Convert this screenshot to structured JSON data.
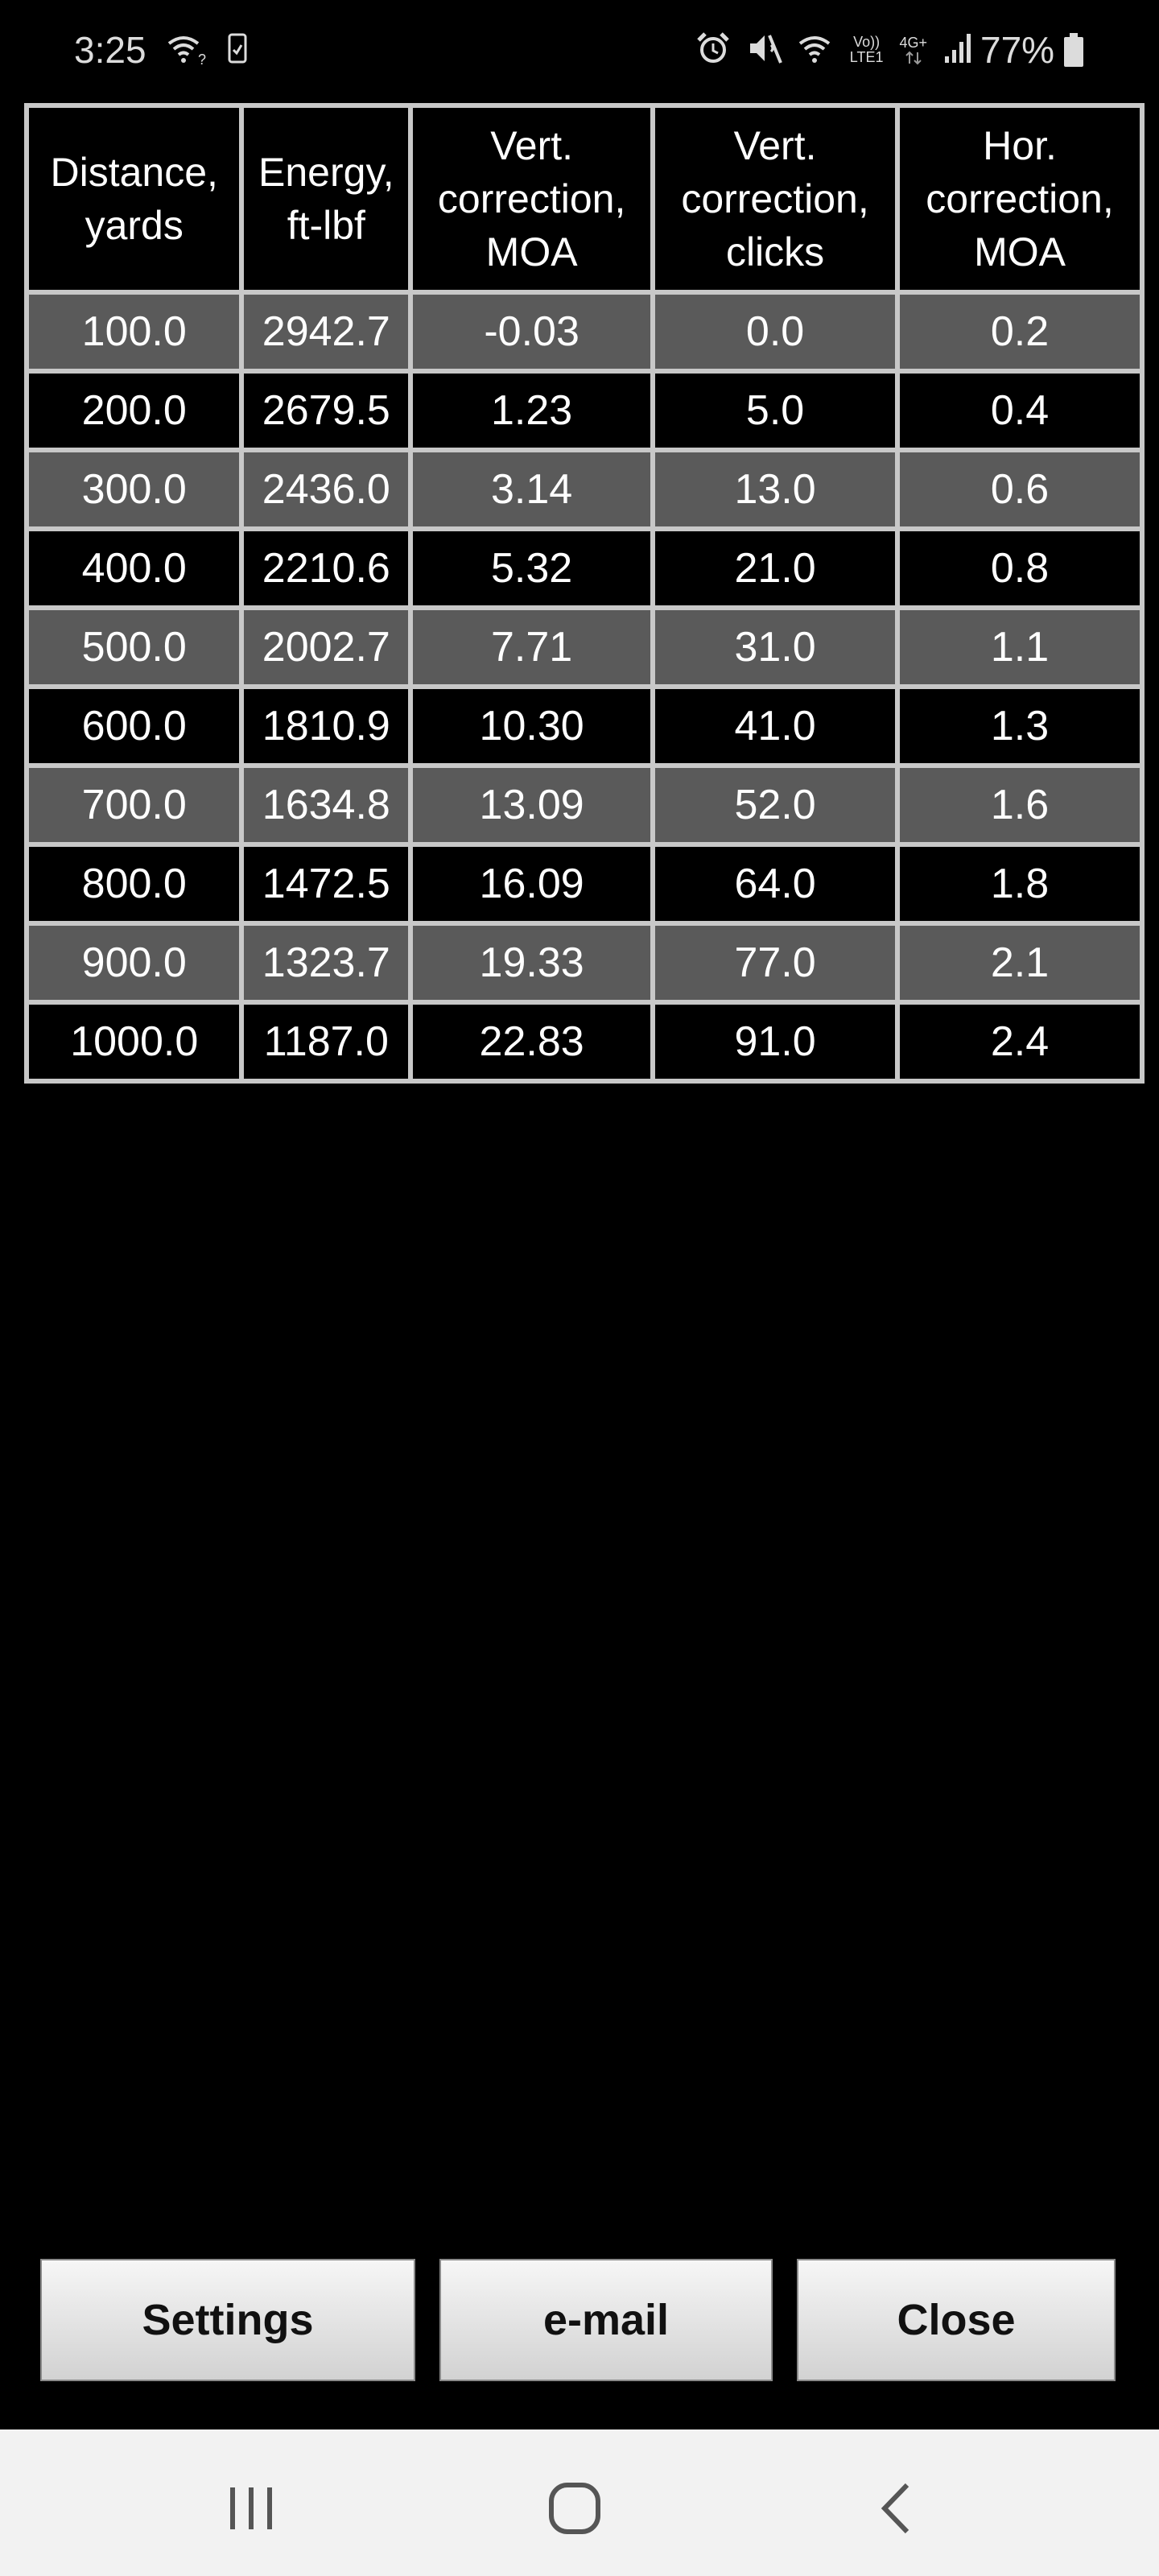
{
  "status_bar": {
    "time": "3:25",
    "battery_percent": "77%",
    "volte_label_top": "Vo))",
    "volte_label_bottom": "LTE1",
    "network_label": "4G+",
    "left_icons": [
      "wifi-question-icon",
      "screenshot-phone-icon"
    ],
    "right_icons": [
      "alarm-icon",
      "mute-icon",
      "wifi-calling-icon",
      "volte-icon",
      "4g-plus-icon",
      "signal-icon",
      "battery-icon"
    ]
  },
  "table": {
    "headers": [
      "Distance, yards",
      "Energy, ft-lbf",
      "Vert. correction, MOA",
      "Vert. correction, clicks",
      "Hor. correction, MOA"
    ],
    "rows": [
      [
        "100.0",
        "2942.7",
        "-0.03",
        "0.0",
        "0.2"
      ],
      [
        "200.0",
        "2679.5",
        "1.23",
        "5.0",
        "0.4"
      ],
      [
        "300.0",
        "2436.0",
        "3.14",
        "13.0",
        "0.6"
      ],
      [
        "400.0",
        "2210.6",
        "5.32",
        "21.0",
        "0.8"
      ],
      [
        "500.0",
        "2002.7",
        "7.71",
        "31.0",
        "1.1"
      ],
      [
        "600.0",
        "1810.9",
        "10.30",
        "41.0",
        "1.3"
      ],
      [
        "700.0",
        "1634.8",
        "13.09",
        "52.0",
        "1.6"
      ],
      [
        "800.0",
        "1472.5",
        "16.09",
        "64.0",
        "1.8"
      ],
      [
        "900.0",
        "1323.7",
        "19.33",
        "77.0",
        "2.1"
      ],
      [
        "1000.0",
        "1187.0",
        "22.83",
        "91.0",
        "2.4"
      ]
    ]
  },
  "buttons": {
    "settings_label": "Settings",
    "email_label": "e-mail",
    "close_label": "Close"
  },
  "nav_bar": {
    "icons": [
      "recents-icon",
      "home-icon",
      "back-icon"
    ]
  },
  "colors": {
    "background": "#000000",
    "row_gray": "#5a5a5a",
    "grid_line": "#c8c8c8",
    "nav_bar": "#f2f2f2"
  }
}
